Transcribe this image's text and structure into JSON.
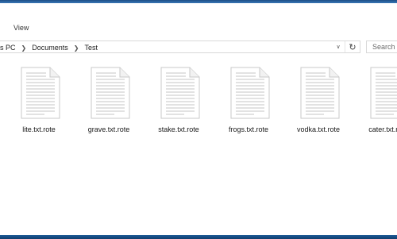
{
  "ribbon": {
    "view_tab": "View"
  },
  "address": {
    "crumbs": [
      "s PC",
      "Documents",
      "Test"
    ]
  },
  "search": {
    "placeholder": "Search"
  },
  "files": [
    {
      "name": "lite.txt.rote",
      "icon": "text-document-icon"
    },
    {
      "name": "grave.txt.rote",
      "icon": "text-document-icon"
    },
    {
      "name": "stake.txt.rote",
      "icon": "text-document-icon"
    },
    {
      "name": "frogs.txt.rote",
      "icon": "text-document-icon"
    },
    {
      "name": "vodka.txt.rote",
      "icon": "text-document-icon"
    },
    {
      "name": "cater.txt.rote",
      "icon": "text-document-icon"
    }
  ],
  "colors": {
    "accent": "#3a77b6",
    "taskbar": "#103e6e"
  }
}
